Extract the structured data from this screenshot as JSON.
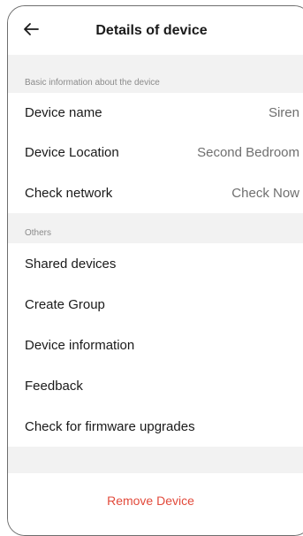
{
  "header": {
    "back_icon": "arrow-left-icon",
    "title": "Details of device"
  },
  "sections": {
    "basic_label": "Basic information about the device",
    "others_label": "Others"
  },
  "basic_rows": [
    {
      "label": "Device name",
      "value": "Siren"
    },
    {
      "label": "Device Location",
      "value": "Second Bedroom"
    },
    {
      "label": "Check network",
      "value": "Check Now"
    }
  ],
  "other_rows": [
    {
      "label": "Shared devices"
    },
    {
      "label": "Create Group"
    },
    {
      "label": "Device information"
    },
    {
      "label": "Feedback"
    },
    {
      "label": "Check for firmware upgrades"
    }
  ],
  "footer": {
    "remove_label": "Remove Device"
  },
  "colors": {
    "danger": "#e24a3b",
    "background": "#f2f2f2"
  }
}
